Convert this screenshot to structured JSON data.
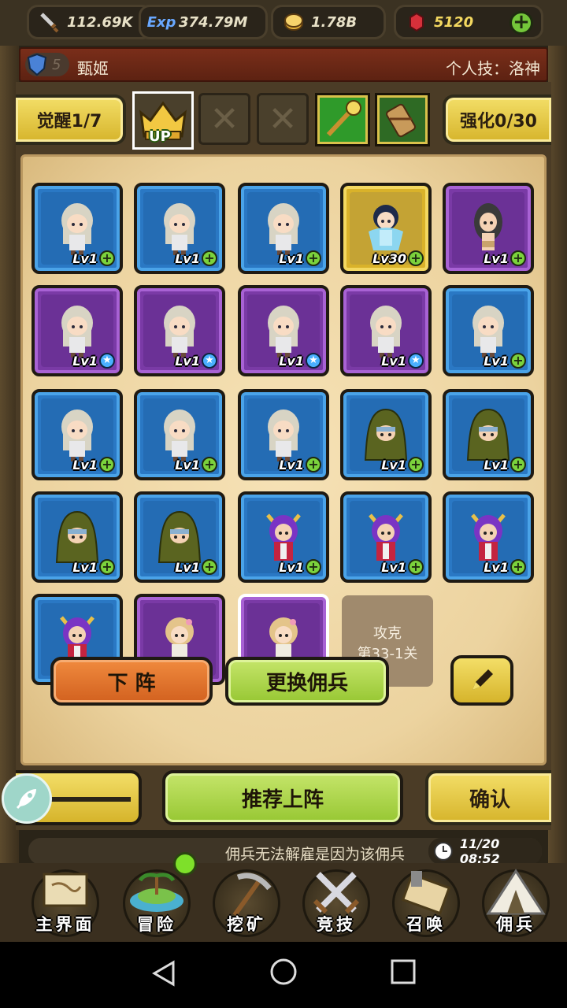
{
  "resources": {
    "attack": "112.69K",
    "exp": "374.79M",
    "gold": "1.78B",
    "gems": "5120",
    "exp_icon_text": "Exp"
  },
  "hero": {
    "shield_level": "5",
    "name": "甄姬",
    "skill": "个人技：洛神"
  },
  "awaken": {
    "label": "觉醒1/7",
    "up_badge": "UP",
    "empty_slot_glyph": "✕",
    "enhance_label": "强化0/30"
  },
  "mercs": [
    {
      "rank": "blue",
      "level": "Lv1",
      "badge": "plus",
      "sprite": "girl"
    },
    {
      "rank": "blue",
      "level": "Lv1",
      "badge": "plus",
      "sprite": "girl"
    },
    {
      "rank": "blue",
      "level": "Lv1",
      "badge": "plus",
      "sprite": "girl"
    },
    {
      "rank": "gold",
      "level": "Lv30",
      "badge": "plus",
      "sprite": "goddess"
    },
    {
      "rank": "purple",
      "level": "Lv1",
      "badge": "plus",
      "sprite": "darkhair"
    },
    {
      "rank": "purple",
      "level": "Lv1",
      "badge": "star",
      "sprite": "girl"
    },
    {
      "rank": "purple",
      "level": "Lv1",
      "badge": "star",
      "sprite": "girl"
    },
    {
      "rank": "purple",
      "level": "Lv1",
      "badge": "star",
      "sprite": "girl"
    },
    {
      "rank": "purple",
      "level": "Lv1",
      "badge": "star",
      "sprite": "girl"
    },
    {
      "rank": "blue",
      "level": "Lv1",
      "badge": "plus",
      "sprite": "girl"
    },
    {
      "rank": "blue",
      "level": "Lv1",
      "badge": "plus",
      "sprite": "girl"
    },
    {
      "rank": "blue",
      "level": "Lv1",
      "badge": "plus",
      "sprite": "girl"
    },
    {
      "rank": "blue",
      "level": "Lv1",
      "badge": "plus",
      "sprite": "girl"
    },
    {
      "rank": "blue",
      "level": "Lv1",
      "badge": "plus",
      "sprite": "hood"
    },
    {
      "rank": "blue",
      "level": "Lv1",
      "badge": "plus",
      "sprite": "hood"
    },
    {
      "rank": "blue",
      "level": "Lv1",
      "badge": "plus",
      "sprite": "hood"
    },
    {
      "rank": "blue",
      "level": "Lv1",
      "badge": "plus",
      "sprite": "hood"
    },
    {
      "rank": "blue",
      "level": "Lv1",
      "badge": "plus",
      "sprite": "horned"
    },
    {
      "rank": "blue",
      "level": "Lv1",
      "badge": "plus",
      "sprite": "horned"
    },
    {
      "rank": "blue",
      "level": "Lv1",
      "badge": "plus",
      "sprite": "horned"
    },
    {
      "rank": "blue",
      "level": "",
      "badge": "",
      "sprite": "horned"
    },
    {
      "rank": "purple",
      "level": "",
      "badge": "",
      "sprite": "blonde"
    },
    {
      "rank": "purple",
      "level": "",
      "badge": "",
      "sprite": "blonde"
    }
  ],
  "locked_slot": {
    "line1": "攻克",
    "line2": "第33-1关"
  },
  "popup": {
    "remove_label": "下 阵",
    "swap_label": "更换佣兵"
  },
  "bottom_buttons": {
    "recommend_label": "推荐上阵",
    "confirm_label": "确认"
  },
  "ticker": {
    "message": "佣兵无法解雇是因为该佣兵",
    "time": "11/20 08:52"
  },
  "nav": [
    {
      "label": "主界面",
      "icon": "map-scroll-icon"
    },
    {
      "label": "冒险",
      "icon": "island-icon"
    },
    {
      "label": "挖矿",
      "icon": "pickaxe-icon"
    },
    {
      "label": "竞技",
      "icon": "crossed-swords-icon"
    },
    {
      "label": "召唤",
      "icon": "summon-scroll-icon"
    },
    {
      "label": "佣兵",
      "icon": "tent-icon"
    }
  ],
  "colors": {
    "blue_card": "#2a78c4",
    "purple_card": "#7a3aa6",
    "gold_card": "#d9b22a",
    "banner": "#7a2e1a",
    "accent_yellow": "#f3de67",
    "accent_green": "#97c733",
    "accent_orange": "#d2611f"
  }
}
